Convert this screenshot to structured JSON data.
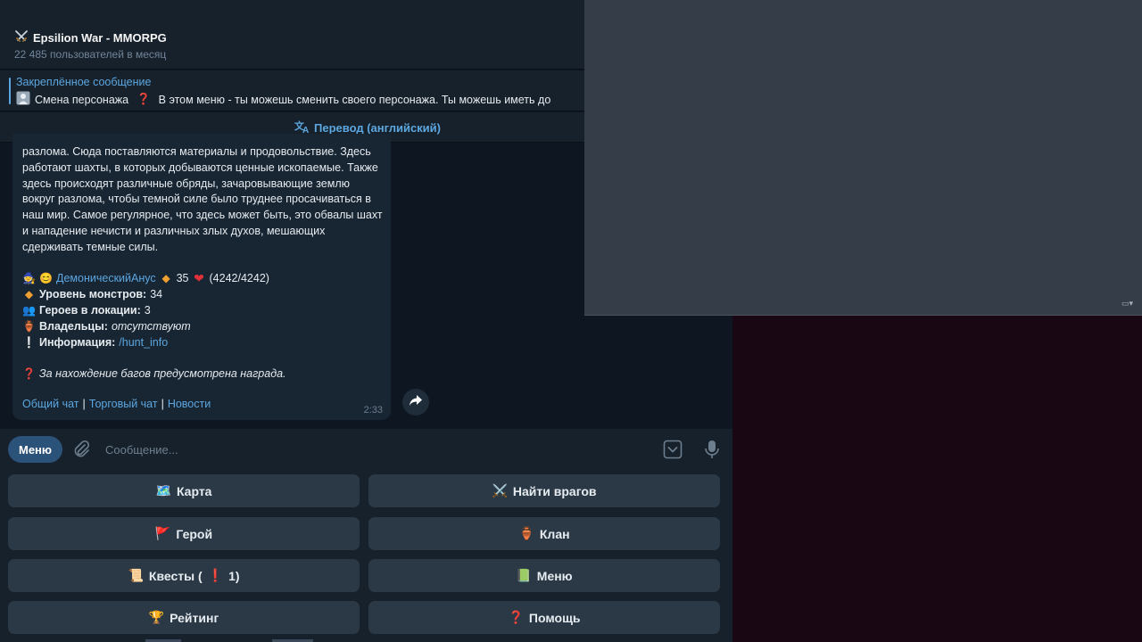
{
  "header": {
    "icon": "crossed-swords",
    "title": "Epsilion War - MMORPG",
    "subtitle": "22 485 пользователей в месяц"
  },
  "pinned": {
    "title": "Закреплённое сообщение",
    "icon": "person-portrait",
    "text_part1": "Смена персонажа",
    "text_part2": "В этом меню - ты можешь сменить своего персонажа. Ты можешь иметь до"
  },
  "translate": {
    "label": "Перевод (английский)"
  },
  "message": {
    "paragraph": "разлома. Сюда поставляются материалы и продовольствие. Здесь работают шахты, в которых добываются ценные ископаемые. Также здесь происходят различные обряды, зачаровывающие землю вокруг разлома, чтобы темной силе было труднее просачиваться в наш мир. Самое регулярное, что здесь может быть, это обвалы шахт и нападение нечисти и различных злых духов, мешающих сдерживать темные силы.",
    "player": {
      "name": "ДемоническийАнус",
      "level": "35",
      "hp": "(4242/4242)"
    },
    "stats": {
      "monsters_label": "Уровень монстров:",
      "monsters_value": "34",
      "heroes_label": "Героев в локации:",
      "heroes_value": "3",
      "owners_label": "Владельцы:",
      "owners_value": "отсутствуют",
      "info_label": "Информация:",
      "info_value": "/hunt_info"
    },
    "bug_note": "За нахождение багов предусмотрена награда.",
    "links": [
      "Общий чат",
      "Торговый чат",
      "Новости"
    ],
    "link_separator": "|",
    "time": "2:33"
  },
  "input": {
    "menu_label": "Меню",
    "placeholder": "Сообщение..."
  },
  "keyboard": {
    "buttons": [
      {
        "emoji": "🗺️",
        "label": "Карта"
      },
      {
        "emoji": "⚔️",
        "label": "Найти врагов"
      },
      {
        "emoji": "🚩",
        "label": "Герой"
      },
      {
        "emoji": "🏺",
        "label": "Клан"
      },
      {
        "emoji": "📜",
        "label": "Квесты (",
        "suffix": "1)"
      },
      {
        "emoji": "📗",
        "label": "Меню"
      },
      {
        "emoji": "🏆",
        "label": "Рейтинг"
      },
      {
        "emoji": "❓",
        "label": "Помощь"
      }
    ]
  },
  "colors": {
    "chat_bg": "#0e1621",
    "header_bg": "#17212b",
    "bubble_bg": "#182533",
    "accent": "#5ca7e0",
    "menu_button": "#2b5278",
    "key_bg": "#2b3947",
    "panel_bg": "#353d49",
    "desktop_bg": "#1a0714"
  }
}
